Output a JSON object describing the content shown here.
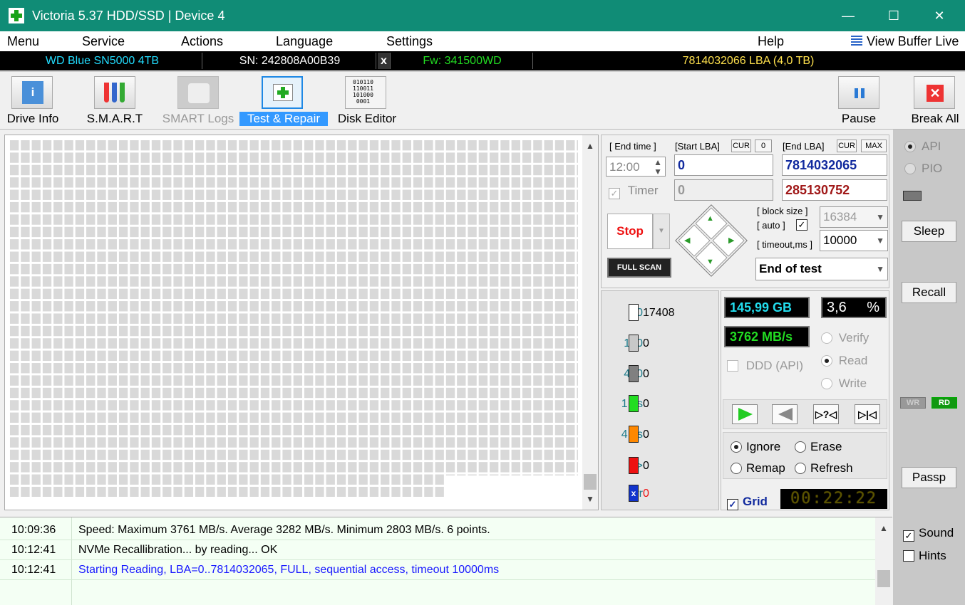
{
  "window": {
    "title": "Victoria 5.37 HDD/SSD | Device 4",
    "minimize": "—",
    "maximize": "☐",
    "close": "✕"
  },
  "menu": {
    "items": [
      "Menu",
      "Service",
      "Actions",
      "Language",
      "Settings",
      "Help"
    ],
    "view_buffer": "View Buffer Live"
  },
  "device": {
    "model": "WD Blue SN5000 4TB",
    "serial": "SN: 242808A00B39",
    "x": "x",
    "firmware": "Fw: 341500WD",
    "lba": "7814032066 LBA (4,0 TB)"
  },
  "toolbar": {
    "drive_info": "Drive Info",
    "smart": "S.M.A.R.T",
    "smart_logs": "SMART Logs",
    "test_repair": "Test & Repair",
    "disk_editor": "Disk Editor",
    "pause": "Pause",
    "break_all": "Break All",
    "disk_editor_bits": "010110\n110011\n101000\n0001"
  },
  "controls": {
    "end_time_label": "[ End time ]",
    "end_time_value": "12:00",
    "start_lba_label": "[Start LBA]",
    "cur_label": "CUR",
    "zero_label": "0",
    "end_lba_label": "[End LBA]",
    "max_label": "MAX",
    "start_lba": "0",
    "end_lba": "7814032065",
    "timer_label": "Timer",
    "timer_value": "0",
    "position": "285130752",
    "stop_label": "Stop",
    "full_scan": "FULL SCAN",
    "block_size_label": "[ block size ]",
    "auto_label": "[ auto ]",
    "block_size": "16384",
    "timeout_label": "[ timeout,ms ]",
    "timeout": "10000",
    "end_action": "End of test"
  },
  "stats": [
    {
      "threshold": "40",
      "count": "17408",
      "color": "#ffffff"
    },
    {
      "threshold": "160",
      "count": "0",
      "color": "#c8c8c8"
    },
    {
      "threshold": "400",
      "count": "0",
      "color": "#808080"
    },
    {
      "threshold": "1,6s",
      "count": "0",
      "color": "#22dd22"
    },
    {
      "threshold": "4,8s",
      "count": "0",
      "color": "#ff8800"
    },
    {
      "threshold": ">",
      "count": "0",
      "color": "#ee1111"
    },
    {
      "threshold": "Err",
      "count": "0",
      "color": "#1133cc"
    }
  ],
  "progress": {
    "scanned": "145,99 GB",
    "percent": "3,6",
    "percent_sign": "%",
    "speed": "3762 MB/s",
    "ddd_label": "DDD (API)",
    "verify": "Verify",
    "read": "Read",
    "write": "Write",
    "ignore": "Ignore",
    "erase": "Erase",
    "remap": "Remap",
    "refresh": "Refresh",
    "grid_label": "Grid",
    "timer": "00:22:22"
  },
  "side": {
    "api": "API",
    "pio": "PIO",
    "sleep": "Sleep",
    "recall": "Recall",
    "wr": "WR",
    "rd": "RD",
    "passp": "Passp",
    "sound": "Sound",
    "hints": "Hints"
  },
  "log": [
    {
      "time": "10:09:36",
      "msg": "Speed: Maximum 3761 MB/s. Average 3282 MB/s. Minimum 2803 MB/s. 6 points.",
      "color": "#000000"
    },
    {
      "time": "10:12:41",
      "msg": "NVMe Recallibration...  by reading... OK",
      "color": "#000000"
    },
    {
      "time": "10:12:41",
      "msg": "Starting Reading, LBA=0..7814032065, FULL, sequential access, timeout 10000ms",
      "color": "#1a1aff"
    }
  ]
}
